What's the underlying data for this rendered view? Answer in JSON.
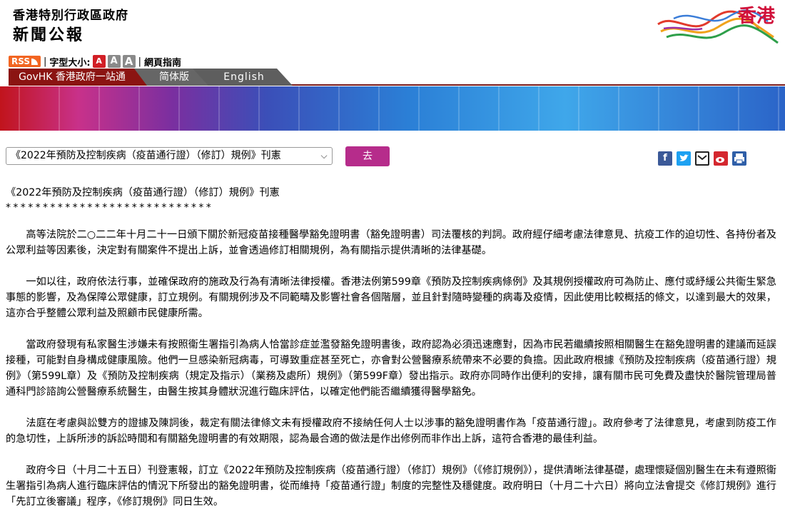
{
  "header": {
    "gov_name": "香港特別行政區政府",
    "section_title": "新聞公報",
    "brand_text": "香港"
  },
  "toolbar": {
    "rss_label": "RSS",
    "font_size_label": "字型大小:",
    "font_small": "A",
    "font_medium": "A",
    "font_large": "A",
    "site_guide": "網頁指南"
  },
  "tabs": {
    "govhk": "GovHK 香港政府一站通",
    "simplified": "简体版",
    "english": "English"
  },
  "nav": {
    "selected_article": "《2022年預防及控制疾病（疫苗通行證）（修訂）規例》刊憲",
    "go_label": "去"
  },
  "share_icons": [
    "facebook-icon",
    "twitter-icon",
    "email-icon",
    "weibo-icon",
    "print-icon"
  ],
  "article": {
    "title": "《2022年預防及控制疾病（疫苗通行證）（修訂）規例》刊憲",
    "separator": "****************************",
    "paragraphs": [
      "高等法院於二○二二年十月二十一日頒下關於新冠疫苗接種醫學豁免證明書（豁免證明書）司法覆核的判詞。政府經仔細考慮法律意見、抗疫工作的迫切性、各持份者及公眾利益等因素後，決定對有關案件不提出上訴，並會透過修訂相關規例，為有關指示提供清晰的法律基礎。",
      "一如以往，政府依法行事，並確保政府的施政及行為有清晰法律授權。香港法例第599章《預防及控制疾病條例》及其規例授權政府可為防止、應付或紓緩公共衞生緊急事態的影響，及為保障公眾健康，訂立規例。有關規例涉及不同範疇及影響社會各個階層，並且針對隨時變種的病毒及疫情，因此使用比較概括的條文，以達到最大的效果，這亦合乎整體公眾利益及照顧市民健康所需。",
      "當政府發現有私家醫生涉嫌未有按照衞生署指引為病人恰當診症並濫發豁免證明書後，政府認為必須迅速應對，因為市民若繼續按照相關醫生在豁免證明書的建議而延誤接種，可能對自身構成健康風險。他們一旦感染新冠病毒，可導致重症甚至死亡，亦會對公營醫療系統帶來不必要的負擔。因此政府根據《預防及控制疾病（疫苗通行證）規例》（第599L章）及《預防及控制疾病（規定及指示）（業務及處所）規例》（第599F章）發出指示。政府亦同時作出便利的安排，讓有關市民可免費及盡快於醫院管理局普通科門診諮詢公營醫療系統醫生，由醫生按其身體狀況進行臨床評估，以確定他們能否繼續獲得醫學豁免。",
      "法庭在考慮與訟雙方的證據及陳詞後，裁定有關法律條文未有授權政府不接納任何人士以涉事的豁免證明書作為「疫苗通行證」。政府參考了法律意見，考慮到防疫工作的急切性，上訴所涉的訴訟時間和有關豁免證明書的有效期限，認為最合適的做法是作出修例而非作出上訴，這符合香港的最佳利益。",
      "政府今日（十月二十五日）刊登憲報，訂立《2022年預防及控制疾病（疫苗通行證）（修訂）規例》（《修訂規例》），提供清晰法律基礎，處理懷疑個別醫生在未有遵照衞生署指引為病人進行臨床評估的情況下所發出的豁免證明書，從而維持「疫苗通行證」制度的完整性及穩健度。政府明日（十月二十六日）將向立法會提交《修訂規例》進行「先訂立後審議」程序，《修訂規例》同日生效。"
    ]
  }
}
